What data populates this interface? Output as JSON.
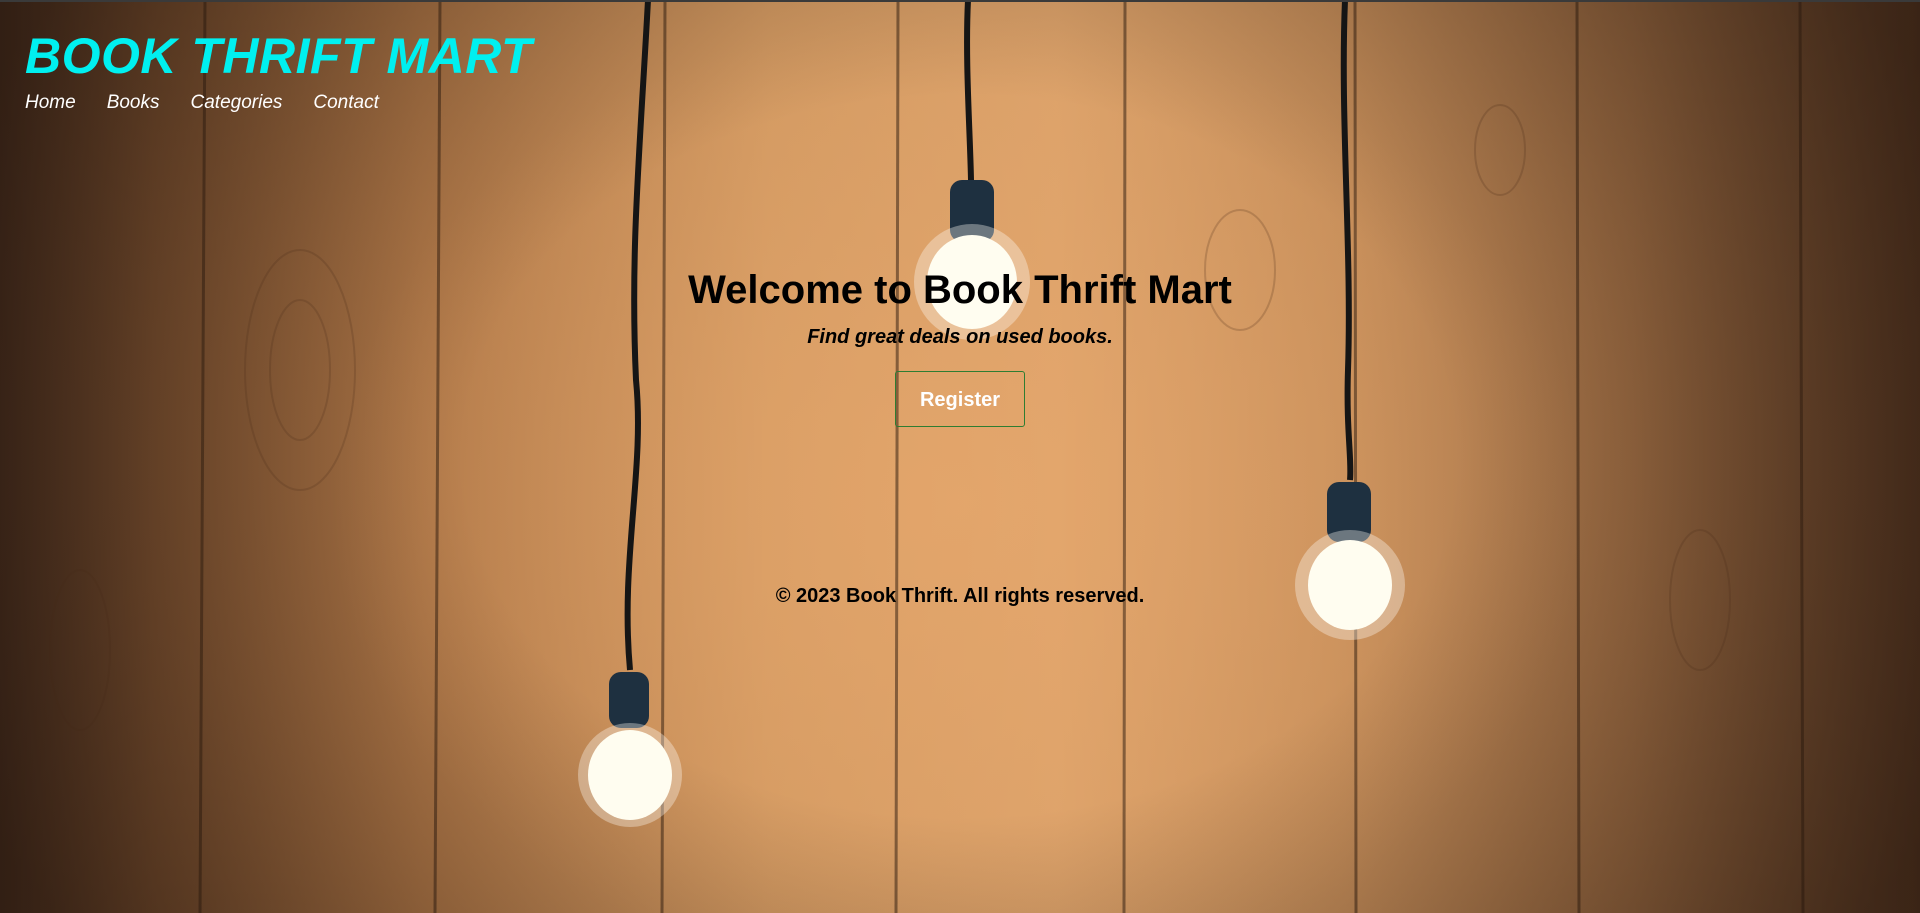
{
  "site": {
    "title": "BOOK THRIFT MART"
  },
  "nav": {
    "items": [
      "Home",
      "Books",
      "Categories",
      "Contact"
    ]
  },
  "hero": {
    "heading": "Welcome to Book Thrift Mart",
    "subheading": "Find great deals on used books.",
    "register_label": "Register"
  },
  "footer": {
    "text": "© 2023 Book Thrift. All rights reserved."
  },
  "colors": {
    "title": "#00f0f0",
    "button_border": "#2e7d32"
  }
}
